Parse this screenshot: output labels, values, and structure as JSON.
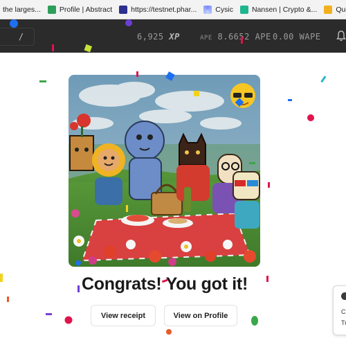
{
  "bookmarks": [
    {
      "label": "the larges...",
      "icon": "none"
    },
    {
      "label": "Profile | Abstract",
      "icon": "abstract-icon"
    },
    {
      "label": "https://testnet.phar...",
      "icon": "pharos-icon"
    },
    {
      "label": "Cysic",
      "icon": "cysic-icon"
    },
    {
      "label": "Nansen | Crypto &...",
      "icon": "nansen-icon"
    },
    {
      "label": "Quests",
      "icon": "quests-icon"
    }
  ],
  "appbar": {
    "slash": "/",
    "xp_value": "6,925",
    "xp_unit": "XP",
    "ape_prefix": "APE",
    "ape_value": "8.6652 APE",
    "wape_value": "0.00 WAPE"
  },
  "main": {
    "title": "Congrats! You got it!",
    "view_receipt": "View receipt",
    "view_on_profile": "View on Profile"
  },
  "toast": {
    "line1": "C",
    "line2": "Tr"
  },
  "colors": {
    "appbar": "#2b2b2b",
    "accent_red": "#e0144c",
    "accent_blue": "#1e6ff0"
  }
}
